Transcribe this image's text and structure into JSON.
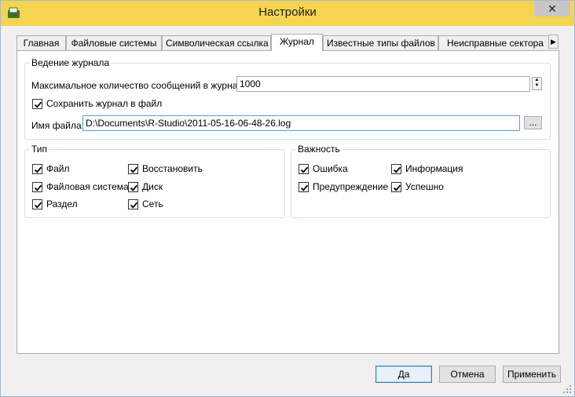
{
  "window": {
    "title": "Настройки",
    "close_glyph": "✕",
    "app_icon": "r-studio-app-icon"
  },
  "tabs": [
    {
      "label": "Главная",
      "active": false
    },
    {
      "label": "Файловые системы",
      "active": false
    },
    {
      "label": "Символическая ссылка",
      "active": false
    },
    {
      "label": "Журнал",
      "active": true
    },
    {
      "label": "Известные типы файлов",
      "active": false
    },
    {
      "label": "Неисправные сектора",
      "active": false
    }
  ],
  "tab_scroll_glyph": "▶",
  "logging": {
    "legend": "Ведение журнала",
    "max_messages_label": "Максимальное количество сообщений в журнале:",
    "max_messages_value": "1000",
    "save_to_file_label": "Сохранить журнал в файл",
    "save_to_file_checked": true,
    "filename_label": "Имя файла:",
    "filename_value": "D:\\Documents\\R-Studio\\2011-05-16-06-48-26.log",
    "browse_label": "..."
  },
  "type_group": {
    "legend": "Тип",
    "items": [
      {
        "label": "Файл",
        "checked": true
      },
      {
        "label": "Восстановить",
        "checked": true
      },
      {
        "label": "Файловая система",
        "checked": true
      },
      {
        "label": "Диск",
        "checked": true
      },
      {
        "label": "Раздел",
        "checked": true
      },
      {
        "label": "Сеть",
        "checked": true
      }
    ]
  },
  "severity_group": {
    "legend": "Важность",
    "items": [
      {
        "label": "Ошибка",
        "checked": true
      },
      {
        "label": "Информация",
        "checked": true
      },
      {
        "label": "Предупреждение",
        "checked": true
      },
      {
        "label": "Успешно",
        "checked": true
      }
    ]
  },
  "buttons": {
    "ok": "Да",
    "cancel": "Отмена",
    "apply": "Применить"
  },
  "colors": {
    "titlebar": "#f5d44f",
    "focus_border": "#569de5"
  }
}
